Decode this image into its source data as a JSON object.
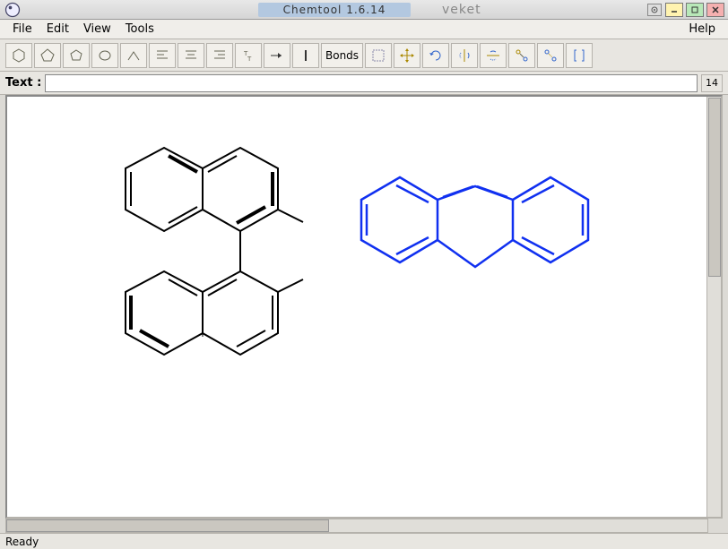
{
  "window": {
    "app_title": "Chemtool 1.6.14",
    "os_title": "veket"
  },
  "menu": {
    "file": "File",
    "edit": "Edit",
    "view": "View",
    "tools": "Tools",
    "help": "Help"
  },
  "toolbar": {
    "bonds_label": "Bonds"
  },
  "text_row": {
    "label": "Text :",
    "value": "",
    "size": "14"
  },
  "status": "Ready",
  "molecules": {
    "left_color": "#000000",
    "right_color": "#1030f0"
  }
}
